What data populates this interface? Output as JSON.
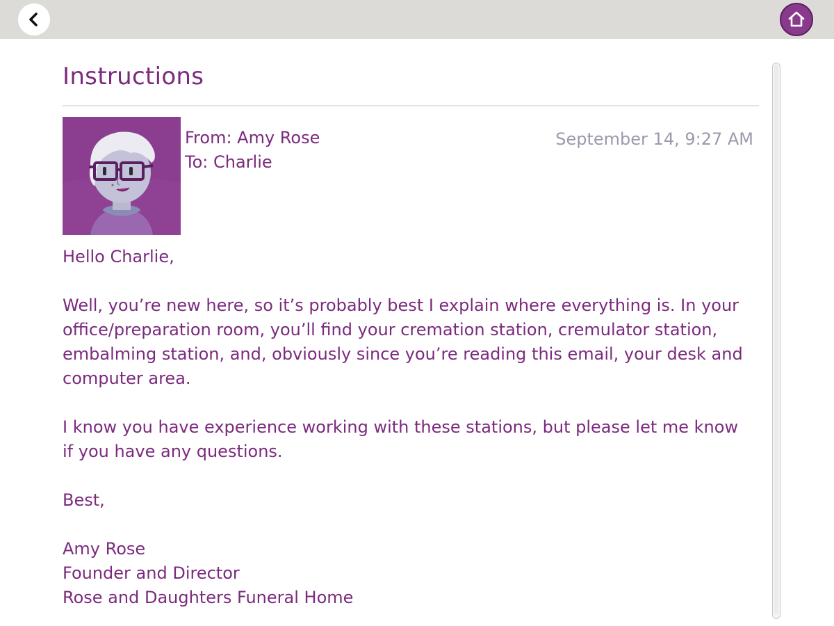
{
  "header": {
    "back_icon": "chevron-left-icon",
    "home_icon": "home-icon",
    "accent_color": "#8a3a8c"
  },
  "email": {
    "title": "Instructions",
    "from": "From: Amy Rose",
    "to": "To: Charlie",
    "date": "September 14, 9:27 AM",
    "greeting": "Hello Charlie,",
    "paragraph1": "Well, you’re new here, so it’s probably best I explain where everything is. In your office/preparation room, you’ll find your cremation station, cremulator station, embalming station, and, obviously since you’re reading this email, your desk and computer area.",
    "paragraph2": "I know you have experience working with these stations, but please let me know if you have any questions.",
    "closing": "Best,",
    "signature_name": "Amy Rose",
    "signature_title": "Founder and Director",
    "signature_company": "Rose and Daughters Funeral Home"
  },
  "colors": {
    "text": "#7b2a7e",
    "date": "#9a9aad",
    "topbar": "#dcdbd7"
  }
}
